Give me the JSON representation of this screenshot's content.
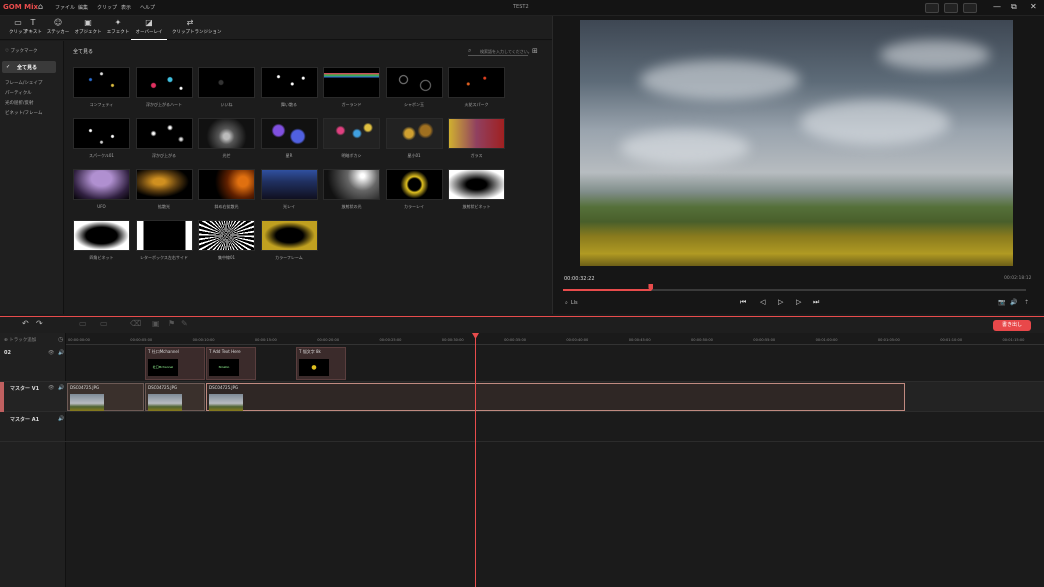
{
  "app": {
    "logo": "GOM Mix",
    "menus": [
      "ファイル",
      "編集",
      "クリップ",
      "表示",
      "ヘルプ"
    ],
    "project_title": "TEST2"
  },
  "window_controls": {
    "minimize": "—",
    "restore": "⧉",
    "close": "✕"
  },
  "tools": [
    {
      "label": "クリップ",
      "icon": "film-icon",
      "glyph": "▭"
    },
    {
      "label": "テキスト",
      "icon": "text-icon",
      "glyph": "T"
    },
    {
      "label": "ステッカー",
      "icon": "sticker-icon",
      "glyph": "☺"
    },
    {
      "label": "オブジェクト",
      "icon": "object-icon",
      "glyph": "▣"
    },
    {
      "label": "エフェクト",
      "icon": "effect-icon",
      "glyph": "✦"
    },
    {
      "label": "オーバーレイ",
      "icon": "overlay-icon",
      "glyph": "◪"
    },
    {
      "label": "クリップトランジション",
      "icon": "transition-icon",
      "glyph": "⇄"
    }
  ],
  "sidebar": {
    "bookmark": "ブックマーク",
    "all": "全て見る",
    "items": [
      "フレーム/シェイプ",
      "パーティクル",
      "光の屈折/反射",
      "ビネット/フレーム"
    ]
  },
  "content": {
    "section_title": "全て見る",
    "search_placeholder": "検索語を入力してください。",
    "overlays": [
      {
        "label": "コンフェティ",
        "bg": "radial-gradient(circle at 30% 40%,#2a6fd6 0 1px,transparent 2px),radial-gradient(circle at 70% 60%,#e0c040 0 1px,transparent 2px),radial-gradient(circle at 50% 20%,#ddd 0 1px,transparent 2px),#000"
      },
      {
        "label": "浮かび上がるハート",
        "bg": "radial-gradient(circle at 30% 60%,#e03060 0 2px,transparent 3px),radial-gradient(circle at 60% 40%,#40c0e0 0 2px,transparent 3px),radial-gradient(circle at 80% 70%,#fff 0 1px,transparent 2px),#000"
      },
      {
        "label": "いいね",
        "bg": "radial-gradient(circle at 40% 50%,#333 0 2px,transparent 3px),#000"
      },
      {
        "label": "舞い散る",
        "bg": "radial-gradient(circle at 30% 30%,#fff 0 1px,transparent 2px),radial-gradient(circle at 55% 55%,#fff 0 1px,transparent 2px),radial-gradient(circle at 75% 35%,#fff 0 1px,transparent 2px),#000"
      },
      {
        "label": "ガーランド",
        "bg": "linear-gradient(180deg,#000 0,#000 18%,#e04060 18%,#40b040 25%,#3070e0 32%,#000 32%)"
      },
      {
        "label": "シャボン玉",
        "bg": "radial-gradient(circle at 30% 40%,transparent 3px,#888 4px,transparent 5px),radial-gradient(circle at 70% 60%,transparent 4px,#777 5px,transparent 6px),#000"
      },
      {
        "label": "火花スパーク",
        "bg": "radial-gradient(circle at 35% 55%,#e06020 0 1px,transparent 2px),radial-gradient(circle at 65% 35%,#e04020 0 1px,transparent 2px),#000"
      },
      {
        "label": "スパークル01",
        "bg": "radial-gradient(circle at 30% 40%,#fff 0 1px,transparent 2px),radial-gradient(circle at 70% 60%,#fff 0 1px,transparent 2px),radial-gradient(circle at 50% 80%,#ccc 0 1px,transparent 2px),#000"
      },
      {
        "label": "浮かび上がる",
        "bg": "radial-gradient(circle at 30% 50%,#fff 0 1px,transparent 3px),radial-gradient(circle at 60% 30%,#fff 0 1px,transparent 3px),radial-gradient(circle at 80% 70%,#ddd 0 1px,transparent 3px),#000"
      },
      {
        "label": "光芒",
        "bg": "radial-gradient(circle at 50% 60%,#bbb 0 3px,#555 8px,#111 20px)"
      },
      {
        "label": "星R",
        "bg": "radial-gradient(circle at 30% 40%,#8050e0 0 5px,transparent 7px),radial-gradient(circle at 65% 60%,#5060e0 0 6px,transparent 8px),#111"
      },
      {
        "label": "明暗ボカシ",
        "bg": "radial-gradient(circle at 30% 40%,#e04080 0 3px,transparent 5px),radial-gradient(circle at 60% 50%,#40a0e0 0 3px,transparent 5px),radial-gradient(circle at 80% 30%,#e0c040 0 3px,transparent 5px),#222"
      },
      {
        "label": "星小01",
        "bg": "radial-gradient(circle at 40% 50%,#d0a030 0 4px,transparent 7px),radial-gradient(circle at 70% 40%,#a07020 0 5px,transparent 8px),#222"
      },
      {
        "label": "ガラス",
        "bg": "linear-gradient(90deg,#d0b030,#904060,#a02020)"
      },
      {
        "label": "UFO",
        "bg": "radial-gradient(ellipse at 50% 30%,#b090d0 0 10px,#302040 28px,#000 40px)"
      },
      {
        "label": "拡散光",
        "bg": "radial-gradient(ellipse at 40% 40%,#d09020 0 6px,#604010 18px,#000 30px)"
      },
      {
        "label": "斜め右拡散光",
        "bg": "radial-gradient(circle at 80% 40%,#e07010 0 5px,#602000 16px,#000 28px)"
      },
      {
        "label": "光レイ",
        "bg": "linear-gradient(180deg,#3050a0 0,#203060 40%,#101020 100%)"
      },
      {
        "label": "放射状の光",
        "bg": "radial-gradient(circle at 70% 20%,#fff 0 2px,#666 15px,#111 35px)"
      },
      {
        "label": "カラーレイ",
        "bg": "radial-gradient(circle,#000 0 6px,#e0c020 8px,#000 14px)"
      },
      {
        "label": "放射状ビネット",
        "bg": "radial-gradient(ellipse,#000 0 10px,#fff 30px)"
      },
      {
        "label": "四角ビネット",
        "bg": "radial-gradient(ellipse,#000 0 40%,#fff 70%)"
      },
      {
        "label": "レターボックス左右サイド",
        "bg": "linear-gradient(90deg,#fff 0 12%,#000 12% 88%,#fff 88%)"
      },
      {
        "label": "集中線01",
        "bg": "repeating-conic-gradient(#fff 0deg 4deg,#000 4deg 10deg)"
      },
      {
        "label": "カラーフレーム",
        "bg": "radial-gradient(ellipse,#000 0 35%,#c0a020 65%)"
      }
    ]
  },
  "preview": {
    "current_time": "00:00:32:22",
    "total_time": "00:02:18:12",
    "progress": 0.19,
    "zoom_icon": "zoom-icon",
    "zoom_label": "Lls",
    "controls": [
      {
        "name": "prev-clip-button",
        "glyph": "⏮"
      },
      {
        "name": "prev-frame-button",
        "glyph": "◁"
      },
      {
        "name": "play-button",
        "glyph": "▷"
      },
      {
        "name": "next-frame-button",
        "glyph": "▷"
      },
      {
        "name": "next-clip-button",
        "glyph": "⏭"
      }
    ],
    "right_tools": [
      "📷",
      "🔊",
      "⇡"
    ]
  },
  "timeline": {
    "toolbar": {
      "undo": "↶",
      "redo": "↷",
      "export_label": "書き出し"
    },
    "add_track": "トラック追加",
    "ticks": [
      "00:00:00:00",
      "00:00:05:00",
      "00:00:10:00",
      "00:00:15:00",
      "00:00:20:00",
      "00:00:25:00",
      "00:00:30:00",
      "00:00:35:00",
      "00:00:40:00",
      "00:00:45:00",
      "00:00:50:00",
      "00:00:55:00",
      "00:01:00:00",
      "00:01:05:00",
      "00:01:10:00",
      "00:01:15:00"
    ],
    "tracks": {
      "overlay": {
        "name": "02"
      },
      "video": {
        "name": "マスター V1"
      },
      "audio": {
        "name": "マスター A1"
      }
    },
    "text_clips": [
      {
        "title": "T 社口Mchannel",
        "thumb": "社口Mchannel"
      },
      {
        "title": "T Add Text Here",
        "thumb": "Ninatio"
      },
      {
        "title": "T 悩文字 8k",
        "thumb": "●"
      }
    ],
    "video_clips": [
      {
        "title": "DSC04725.JPG"
      },
      {
        "title": "DSC04725.JPG"
      },
      {
        "title": "DSC04725.JPG"
      }
    ]
  }
}
